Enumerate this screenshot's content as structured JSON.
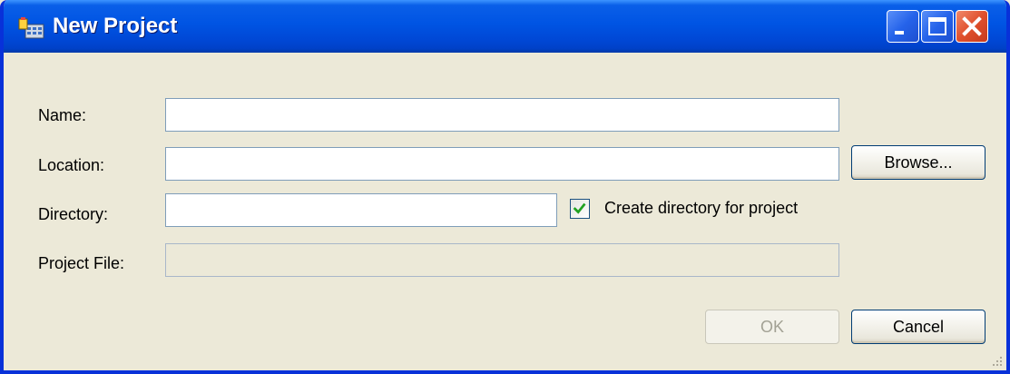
{
  "window": {
    "title": "New Project"
  },
  "form": {
    "name_label": "Name:",
    "name_value": "",
    "location_label": "Location:",
    "location_value": "",
    "browse_label": "Browse...",
    "directory_label": "Directory:",
    "directory_value": "",
    "create_dir_label": "Create directory for project",
    "create_dir_checked": true,
    "project_file_label": "Project File:",
    "project_file_value": ""
  },
  "actions": {
    "ok_label": "OK",
    "cancel_label": "Cancel"
  },
  "colors": {
    "titlebar": "#0054e3",
    "window_bg": "#ece9d8",
    "check_mark": "#21a121",
    "close_button": "#e0502c"
  }
}
